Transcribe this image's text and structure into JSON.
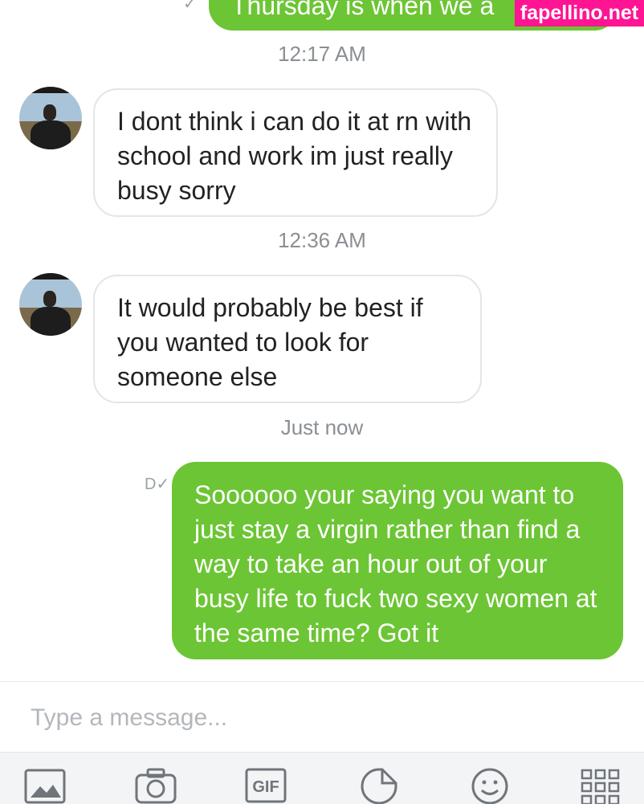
{
  "chat": {
    "partial_sent_message": "Thursday is when we a",
    "messages": [
      {
        "time": "12:17 AM",
        "text": "I dont think i can do it at rn with school and work im just really busy sorry"
      },
      {
        "time": "12:36 AM",
        "text": "It would probably be best if you wanted to look for someone else"
      },
      {
        "time": "Just now",
        "text": "Soooooo your saying you want to just stay a virgin rather than find a way to take an hour out of your busy life to fuck two sexy women at the same time? Got it"
      }
    ]
  },
  "watermark": "fapellino.net",
  "composer": {
    "placeholder": "Type a message..."
  },
  "toolbar": {
    "gif_label": "GIF",
    "icons": [
      "photo-icon",
      "camera-icon",
      "gif-icon",
      "sticker-icon",
      "emoji-icon",
      "grid-icon"
    ]
  },
  "colors": {
    "sent_bubble": "#6cc534",
    "received_border": "#e3e5e7",
    "watermark_bg": "#ff1493"
  }
}
